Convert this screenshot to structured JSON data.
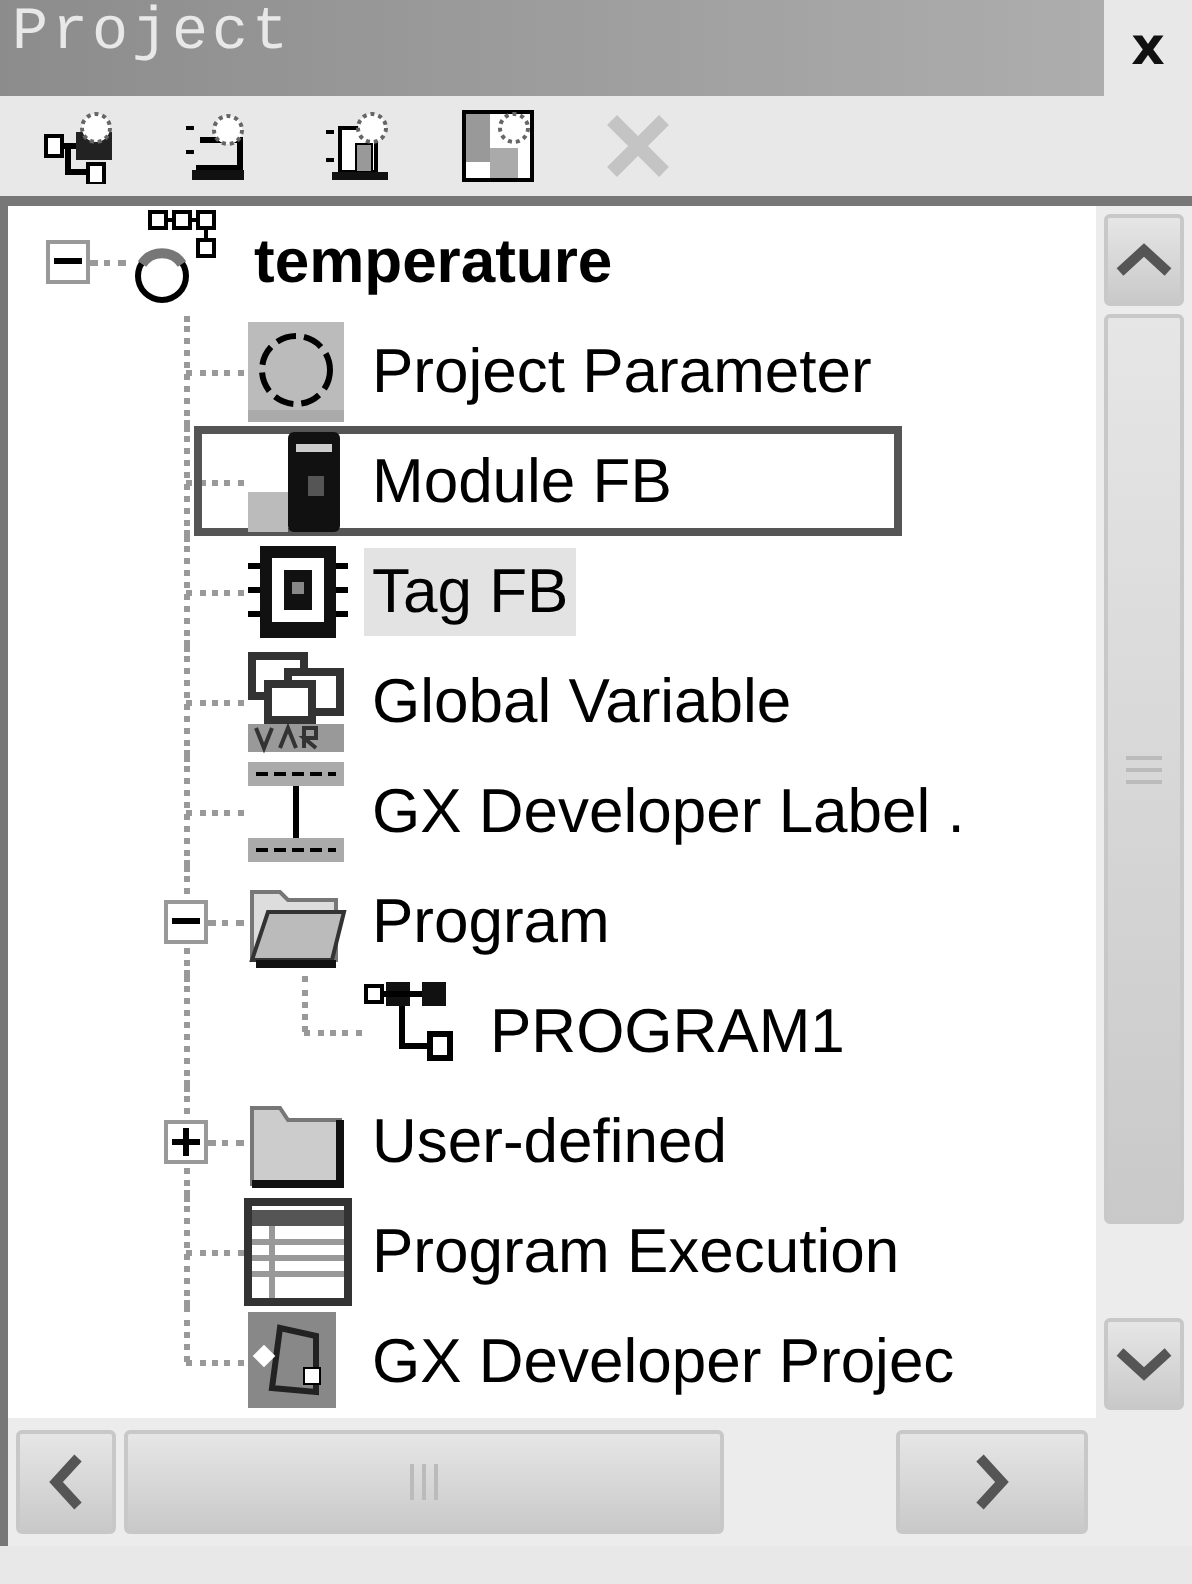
{
  "window": {
    "title": "Project",
    "close": "x"
  },
  "toolbar": [
    {
      "kind": "new-project",
      "disabled": false
    },
    {
      "kind": "new-item",
      "disabled": false
    },
    {
      "kind": "new-module",
      "disabled": false
    },
    {
      "kind": "layout",
      "disabled": false
    },
    {
      "kind": "delete",
      "disabled": true
    }
  ],
  "tree": [
    {
      "label": "temperature",
      "kind": "project",
      "expanded": true,
      "selected": false,
      "outlined": false,
      "children": [
        {
          "label": "Project Parameter",
          "kind": "parameter",
          "selected": false,
          "outlined": false
        },
        {
          "label": "Module FB",
          "kind": "module",
          "selected": false,
          "outlined": true
        },
        {
          "label": "Tag FB",
          "kind": "tag",
          "selected": true,
          "outlined": false
        },
        {
          "label": "Global Variable",
          "kind": "variable",
          "selected": false,
          "outlined": false
        },
        {
          "label": "GX Developer Label .",
          "kind": "label",
          "selected": false,
          "outlined": false
        },
        {
          "label": "Program",
          "kind": "folder-open",
          "expanded": true,
          "selected": false,
          "outlined": false,
          "children": [
            {
              "label": "PROGRAM1",
              "kind": "program",
              "selected": false,
              "outlined": false
            }
          ]
        },
        {
          "label": "User-defined",
          "kind": "folder",
          "expanded": false,
          "selected": false,
          "outlined": false
        },
        {
          "label": "Program Execution",
          "kind": "execution",
          "selected": false,
          "outlined": false
        },
        {
          "label": "GX Developer Projec",
          "kind": "gx-project",
          "selected": false,
          "outlined": false
        }
      ]
    }
  ]
}
